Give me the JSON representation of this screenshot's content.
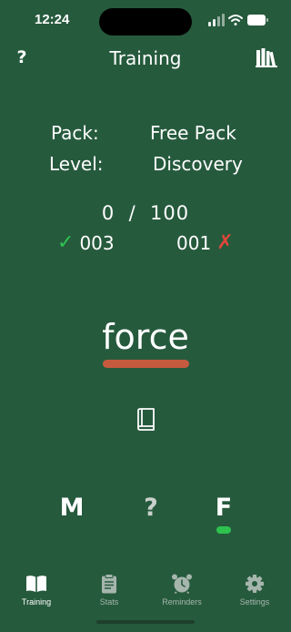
{
  "status": {
    "time": "12:24"
  },
  "nav": {
    "help_label": "?",
    "title": "Training",
    "library_icon": "books-icon"
  },
  "info": {
    "pack_label": "Pack:",
    "pack_value": "Free Pack",
    "level_label": "Level:",
    "level_value": "Discovery"
  },
  "progress": {
    "text": "0  /  100",
    "current": 0,
    "total": 100
  },
  "score": {
    "correct": "003",
    "wrong": "001",
    "check_mark": "✓",
    "cross_mark": "✗"
  },
  "word": {
    "text": "force"
  },
  "answers": {
    "m": "M",
    "unknown": "?",
    "f": "F"
  },
  "tabs": [
    {
      "label": "Training",
      "icon": "book-open-icon",
      "active": true
    },
    {
      "label": "Stats",
      "icon": "clipboard-icon",
      "active": false
    },
    {
      "label": "Reminders",
      "icon": "alarm-clock-icon",
      "active": false
    },
    {
      "label": "Settings",
      "icon": "gear-icon",
      "active": false
    }
  ],
  "colors": {
    "background": "#265a3d",
    "correct": "#2ec24f",
    "wrong": "#e0463a",
    "word_underline": "#c65a3e",
    "tab_inactive": "#a6b6ad"
  }
}
